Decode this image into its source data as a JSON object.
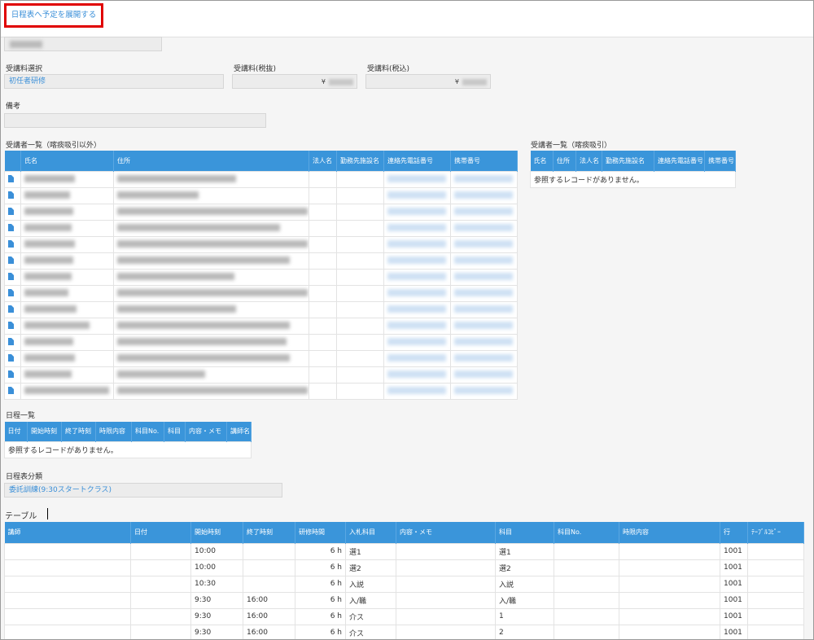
{
  "top_button": "日程表へ予定を展開する",
  "fields": {
    "course_fee_select_label": "受講料選択",
    "course_fee_select_value": "初任者研修",
    "fee_excl_tax_label": "受講料(税抜)",
    "fee_incl_tax_label": "受講料(税込)",
    "currency_symbol": "¥",
    "remarks_label": "備考"
  },
  "trainees_excl": {
    "title": "受講者一覧（喀痰吸引以外）",
    "headers": [
      "氏名",
      "住所",
      "法人名",
      "勤務先施設名",
      "連絡先電話番号",
      "携帯番号"
    ],
    "row_count": 14
  },
  "trainees_incl": {
    "title": "受講者一覧（喀痰吸引）",
    "headers": [
      "氏名",
      "住所",
      "法人名",
      "勤務先施設名",
      "連絡先電話番号",
      "携帯番号"
    ],
    "empty": "参照するレコードがありません。"
  },
  "schedule": {
    "title": "日程一覧",
    "headers": [
      "日付",
      "開始時刻",
      "終了時刻",
      "時限内容",
      "科目No.",
      "科目",
      "内容・メモ",
      "講師名"
    ],
    "empty": "参照するレコードがありません。"
  },
  "schedule_class": {
    "label": "日程表分類",
    "value": "委託訓練(9:30スタートクラス)"
  },
  "table": {
    "title": "テーブル",
    "headers": [
      "講師",
      "日付",
      "開始時刻",
      "終了時刻",
      "研修時間",
      "入札科目",
      "内容・メモ",
      "科目",
      "科目No.",
      "時限内容",
      "行",
      "ﾃｰﾌﾞﾙｺﾋﾟｰ"
    ],
    "rows": [
      {
        "start": "10:00",
        "end": "",
        "hours": "6 h",
        "bid": "選1",
        "subject": "選1",
        "row": "1001"
      },
      {
        "start": "10:00",
        "end": "",
        "hours": "6 h",
        "bid": "選2",
        "subject": "選2",
        "row": "1001"
      },
      {
        "start": "10:30",
        "end": "",
        "hours": "6 h",
        "bid": "入説",
        "subject": "入説",
        "row": "1001"
      },
      {
        "start": "9:30",
        "end": "16:00",
        "hours": "6 h",
        "bid": "入/職",
        "subject": "入/職",
        "row": "1001"
      },
      {
        "start": "9:30",
        "end": "16:00",
        "hours": "6 h",
        "bid": "介ス",
        "subject": "1",
        "row": "1001"
      },
      {
        "start": "9:30",
        "end": "16:00",
        "hours": "6 h",
        "bid": "介ス",
        "subject": "2",
        "row": "1001"
      }
    ]
  }
}
